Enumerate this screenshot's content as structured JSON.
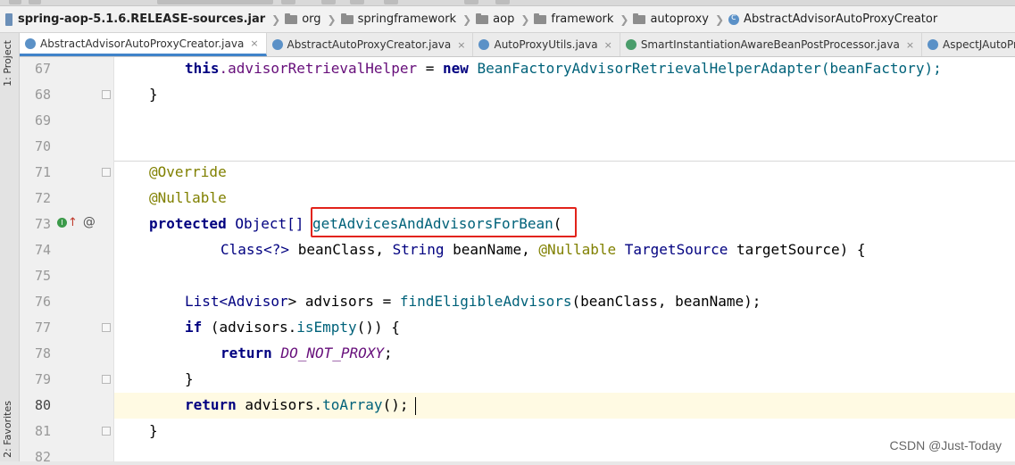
{
  "breadcrumb": {
    "jar": "spring-aop-5.1.6.RELEASE-sources.jar",
    "items": [
      "org",
      "springframework",
      "aop",
      "framework",
      "autoproxy"
    ],
    "class": "AbstractAdvisorAutoProxyCreator"
  },
  "tabs": [
    {
      "label": "AbstractAdvisorAutoProxyCreator.java",
      "active": true,
      "close": "×"
    },
    {
      "label": "AbstractAutoProxyCreator.java",
      "close": "×"
    },
    {
      "label": "AutoProxyUtils.java",
      "close": "×"
    },
    {
      "label": "SmartInstantiationAwareBeanPostProcessor.java",
      "close": "×"
    },
    {
      "label": "AspectJAutoProxy"
    }
  ],
  "side_panels": {
    "project": "1: Project",
    "favorites": "2: Favorites"
  },
  "gutter": {
    "line_numbers": [
      "67",
      "68",
      "69",
      "70",
      "71",
      "72",
      "73",
      "74",
      "75",
      "76",
      "77",
      "78",
      "79",
      "80",
      "81",
      "82"
    ],
    "current_line": "80",
    "override_marker": "@"
  },
  "code": {
    "l67": {
      "this": "this",
      "field": ".advisorRetrievalHelper",
      "eq": " = ",
      "new": "new",
      "rest": " BeanFactoryAdvisorRetrievalHelperAdapter(beanFactory);"
    },
    "l68": "}",
    "l71": "@Override",
    "l72": "@Nullable",
    "l73": {
      "kw": "protected",
      "type": " Object[] ",
      "method": "getAdvicesAndAdvisorsForBean",
      "paren": "("
    },
    "l74": {
      "a": "Class<?>",
      "b": " beanClass, ",
      "c": "String",
      "d": " beanName, ",
      "e": "@Nullable",
      "f": " ",
      "g": "TargetSource",
      "h": " targetSource) {"
    },
    "l76": {
      "a": "List<",
      "b": "Advisor",
      "c": "> advisors = ",
      "d": "findEligibleAdvisors",
      "e": "(beanClass, beanName);"
    },
    "l77": {
      "kw": "if",
      "a": " (advisors.",
      "m": "isEmpty",
      "b": "()) {"
    },
    "l78": {
      "kw": "return",
      "sp": " ",
      "c": "DO_NOT_PROXY",
      "semi": ";"
    },
    "l79": "}",
    "l80": {
      "kw": "return",
      "a": " advisors.",
      "m": "toArray",
      "b": "();"
    },
    "l81": "}"
  },
  "watermark": "CSDN @Just-Today",
  "colors": {
    "keyword": "#000080",
    "annotation": "#808000",
    "field": "#660e7a",
    "method": "#00627a",
    "highlight_box": "#e2231a",
    "current_line": "#fffae3"
  }
}
